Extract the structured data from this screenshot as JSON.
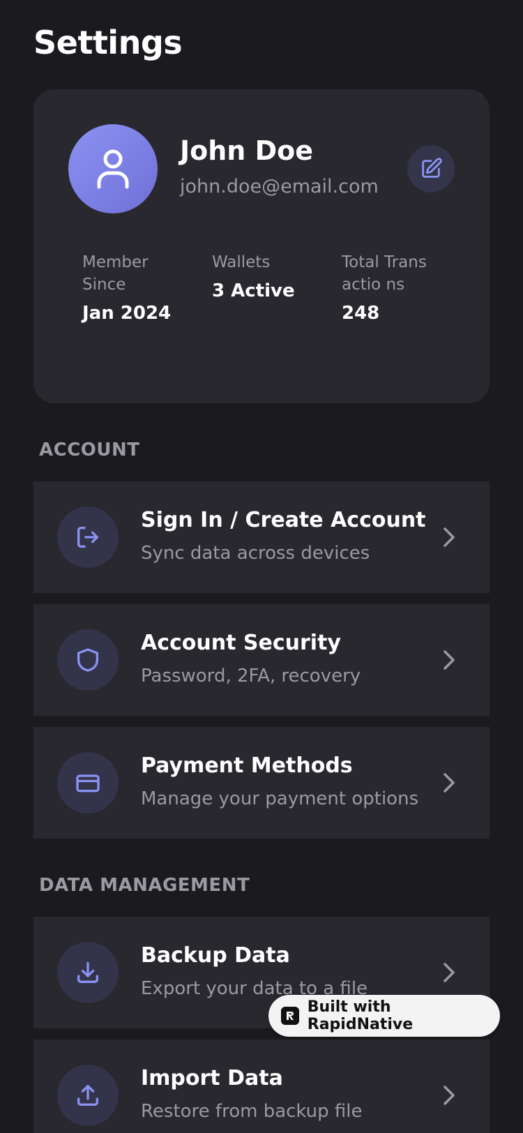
{
  "page": {
    "title": "Settings"
  },
  "profile": {
    "name": "John Doe",
    "email": "john.doe@email.com",
    "stats": [
      {
        "label": "Member Since",
        "value": "Jan 2024"
      },
      {
        "label": "Wallets",
        "value": "3 Active"
      },
      {
        "label": "Total Transactio ns",
        "value": "248"
      }
    ]
  },
  "sections": {
    "account": {
      "header": "ACCOUNT",
      "items": [
        {
          "title": "Sign In / Create Account",
          "subtitle": "Sync data across devices",
          "icon": "sign-in-icon"
        },
        {
          "title": "Account Security",
          "subtitle": "Password, 2FA, recovery",
          "icon": "shield-icon"
        },
        {
          "title": "Payment Methods",
          "subtitle": "Manage your payment options",
          "icon": "credit-card-icon"
        }
      ]
    },
    "data_management": {
      "header": "DATA MANAGEMENT",
      "items": [
        {
          "title": "Backup Data",
          "subtitle": "Export your data to a file",
          "icon": "download-icon"
        },
        {
          "title": "Import Data",
          "subtitle": "Restore from backup file",
          "icon": "upload-icon"
        }
      ]
    }
  },
  "badge": {
    "text": "Built with RapidNative"
  },
  "colors": {
    "background": "#1b1b1f",
    "card": "#28282e",
    "accent": "#8b93f2",
    "icon_circle": "#33334a",
    "muted_text": "#9a9aa2"
  }
}
